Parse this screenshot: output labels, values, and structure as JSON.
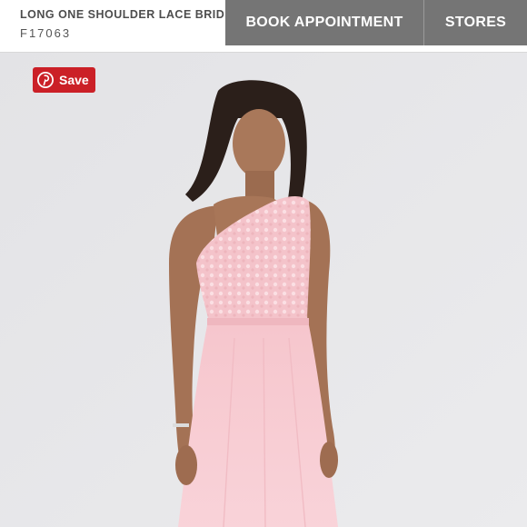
{
  "header": {
    "product_title": "LONG ONE SHOULDER LACE BRIDE",
    "product_sku": "F17063",
    "book_label": "BOOK APPOINTMENT",
    "stores_label": "STORES"
  },
  "pin": {
    "label": "Save",
    "icon": "pinterest-icon"
  },
  "photo": {
    "icon": "product-photo"
  },
  "colors": {
    "button_gray": "#757575",
    "pinterest_red": "#cb2027",
    "dress_pink": "#f7ccd2"
  }
}
